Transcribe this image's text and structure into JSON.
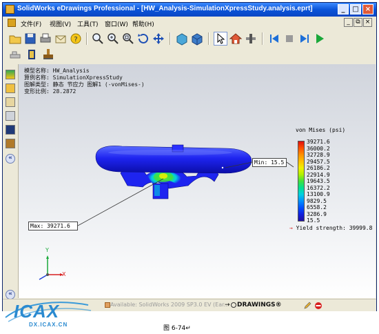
{
  "window": {
    "title": "SolidWorks eDrawings Professional - [HW_Analysis-SimulationXpressStudy.analysis.eprt]",
    "title_buttons": [
      "_",
      "□",
      "×"
    ]
  },
  "menu": {
    "items": [
      "文件(F)",
      "视图(V)",
      "工具(T)",
      "窗口(W)",
      "帮助(H)"
    ],
    "mdi_buttons": [
      "_",
      "⧉",
      "×"
    ]
  },
  "toolbar": {
    "icons": [
      "open-icon",
      "save-icon",
      "print-icon",
      "send-icon",
      "help-icon",
      "zoom-fit-icon",
      "zoom-in-icon",
      "zoom-area-icon",
      "rotate-icon",
      "pan-icon",
      "shaded-view-icon",
      "view-3d-icon",
      "select-icon",
      "home-icon",
      "cross-section-icon",
      "first-frame-icon",
      "stop-icon",
      "next-frame-icon",
      "play-icon"
    ]
  },
  "info": {
    "model": "模型名称: HW_Analysis",
    "study": "算例名称: SimulationXpressStudy",
    "plot": "图解类型: 静态 节应力 图解1 (-vonMises-)",
    "deform": "变形比例: 28.2872"
  },
  "legend": {
    "title": "von Mises (psi)",
    "labels": [
      "39271.6",
      "36000.2",
      "32728.9",
      "29457.5",
      "26186.2",
      "22914.9",
      "19643.5",
      "16372.2",
      "13100.9",
      "9829.5",
      "6558.2",
      "3286.9",
      "15.5"
    ],
    "colors": [
      "#e01010",
      "#ff5000",
      "#ff9000",
      "#ffc000",
      "#f0f000",
      "#b0f000",
      "#40e040",
      "#00e090",
      "#00d0e0",
      "#0090ff",
      "#0050ff",
      "#1020e0",
      "#2010a0"
    ],
    "yield_arrow": "→",
    "yield": "Yield strength: 39999.8"
  },
  "labels": {
    "max": "Max: 39271.6",
    "min": "Min: 15.5"
  },
  "triad": {
    "x": "X",
    "y": "Y"
  },
  "status": {
    "text": "Available: SolidWorks 2009 SP3.0 EV (Ear...",
    "drawings": "DRAWINGS®"
  },
  "watermark": {
    "logo": "ICAX",
    "url": "DX.ICAX.CN"
  },
  "caption": "图 6-74↵"
}
